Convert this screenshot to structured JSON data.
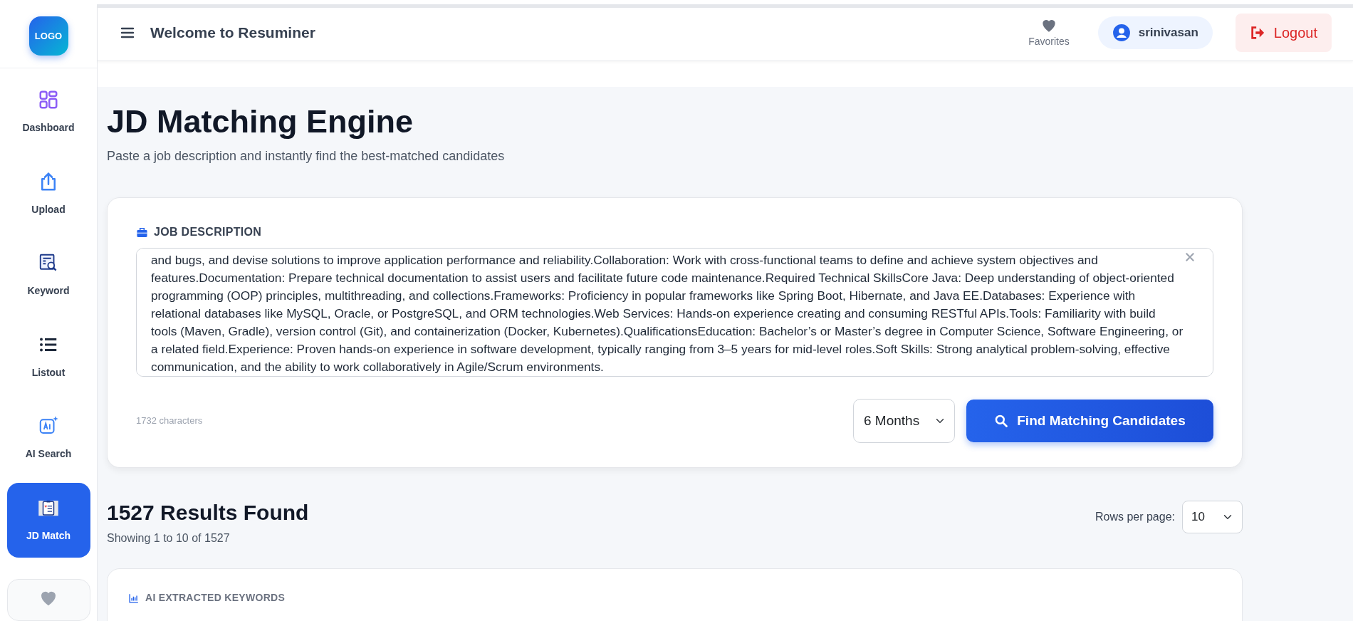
{
  "sidebar": {
    "logo": "LOGO",
    "items": [
      {
        "label": "Dashboard",
        "selected": false
      },
      {
        "label": "Upload",
        "selected": false
      },
      {
        "label": "Keyword",
        "selected": false
      },
      {
        "label": "Listout",
        "selected": false
      },
      {
        "label": "AI Search",
        "selected": false
      },
      {
        "label": "JD Match",
        "selected": true
      },
      {
        "selected": false
      }
    ]
  },
  "header": {
    "welcome": "Welcome to **Resuminer**",
    "favorites": "Favorites",
    "user": "srinivasan",
    "logout": "Logout"
  },
  "page": {
    "title": "JD Matching Engine",
    "subtitle": "Paste a job description and instantly find the best-matched candidates"
  },
  "jd_card": {
    "label": "JOB DESCRIPTION",
    "value": "and bugs, and devise solutions to improve application performance and reliability.Collaboration: Work with cross-functional teams to define and achieve system objectives and features.Documentation: Prepare technical documentation to assist users and facilitate future code maintenance.Required Technical SkillsCore Java: Deep understanding of object-oriented programming (OOP) principles, multithreading, and collections.Frameworks: Proficiency in popular frameworks like Spring Boot, Hibernate, and Java EE.Databases: Experience with relational databases like MySQL, Oracle, or PostgreSQL, and ORM technologies.Web Services: Hands-on experience creating and consuming RESTful APIs.Tools: Familiarity with build tools (Maven, Gradle), version control (Git), and containerization (Docker, Kubernetes).QualificationsEducation: Bachelor’s or Master’s degree in Computer Science, Software Engineering, or a related field.Experience: Proven hands-on experience in software development, typically ranging from 3–5 years for mid-level roles.Soft Skills: Strong analytical problem-solving, effective communication, and the ability to work collaboratively in Agile/Scrum environments.",
    "char_count": "1732 characters",
    "period": "6 Months",
    "button": "Find Matching Candidates"
  },
  "results": {
    "heading": "1527 Results Found",
    "summary": "Showing 1 to 10 of 1527",
    "rows_label": "Rows per page:",
    "rows_value": "10"
  },
  "keywords": {
    "title": "AI EXTRACTED KEYWORDS"
  }
}
